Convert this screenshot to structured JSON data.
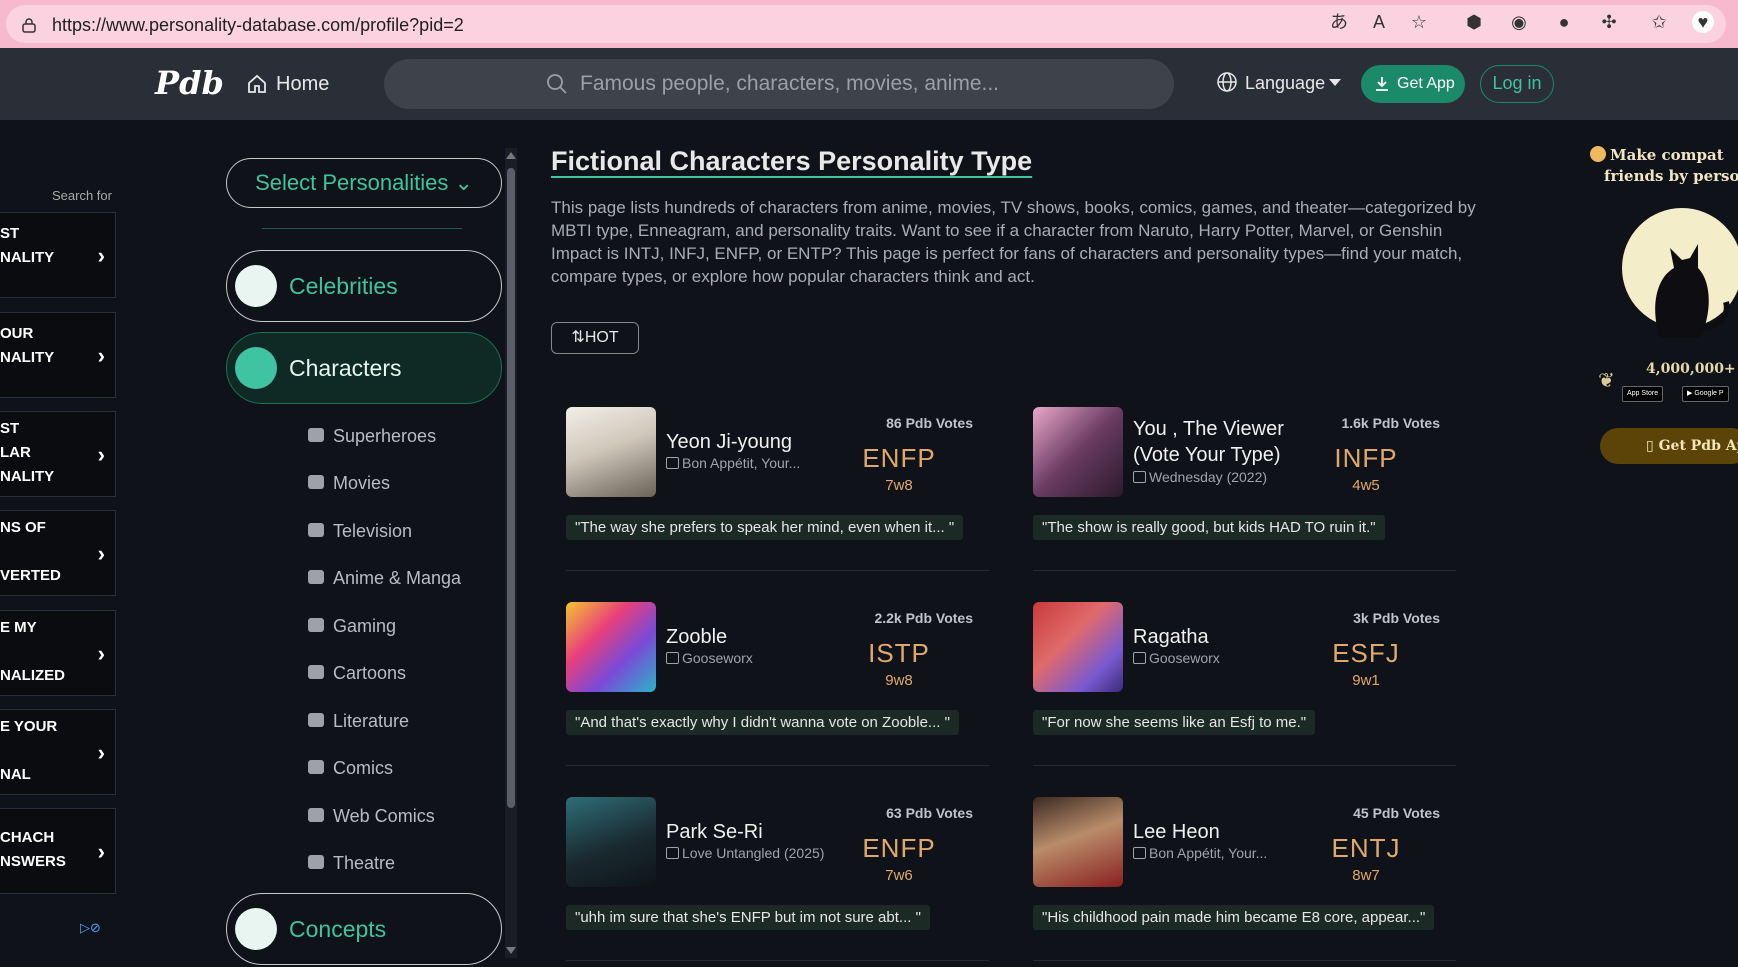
{
  "browser": {
    "url": "https://www.personality-database.com/profile?pid=2"
  },
  "nav": {
    "logo": "Pdb",
    "home": "Home",
    "search_placeholder": "Famous people, characters, movies, anime...",
    "language": "Language",
    "get_app": "Get App",
    "login": "Log in"
  },
  "ad": {
    "search_for": "Search for",
    "items": [
      {
        "line1": "ST",
        "line2": "NALITY"
      },
      {
        "line1": "OUR",
        "line2": "NALITY"
      },
      {
        "line1": "ST",
        "line2": "LAR",
        "line3": "NALITY"
      },
      {
        "line1": "NS OF",
        "line2": "VERTED"
      },
      {
        "line1": "E MY",
        "line2": "NALIZED"
      },
      {
        "line1": "E YOUR",
        "line2": "NAL"
      },
      {
        "line1": "CHACH",
        "line2": "NSWERS"
      }
    ]
  },
  "sidebar": {
    "select": "Select Personalities",
    "categories": [
      {
        "label": "Celebrities"
      },
      {
        "label": "Characters"
      },
      {
        "label": "Concepts"
      }
    ],
    "subcategories": [
      {
        "label": "Superheroes"
      },
      {
        "label": "Movies"
      },
      {
        "label": "Television"
      },
      {
        "label": "Anime & Manga"
      },
      {
        "label": "Gaming"
      },
      {
        "label": "Cartoons"
      },
      {
        "label": "Literature"
      },
      {
        "label": "Comics"
      },
      {
        "label": "Web Comics"
      },
      {
        "label": "Theatre"
      }
    ]
  },
  "main": {
    "title": "Fictional Characters Personality Type",
    "description": "This page lists hundreds of characters from anime, movies, TV shows, books, comics, games, and theater—categorized by MBTI type, Enneagram, and personality traits. Want to see if a character from Naruto, Harry Potter, Marvel, or Genshin Impact is INTJ, INFJ, ENFP, or ENTP? This page is perfect for fans of characters and personality types—find your match, compare types, or explore how popular characters think and act.",
    "sort": "HOT",
    "cards": [
      {
        "name": "Yeon Ji-young",
        "source": "Bon Appétit, Your...",
        "votes": "86 Pdb Votes",
        "type": "ENFP",
        "enneagram": "7w8",
        "quote": "\"The way she prefers to speak her mind, even when it...  \""
      },
      {
        "name": "You , The Viewer (Vote Your Type)",
        "source": "Wednesday (2022)",
        "votes": "1.6k Pdb Votes",
        "type": "INFP",
        "enneagram": "4w5",
        "quote": "\"The show is really good, but kids HAD TO ruin it.\""
      },
      {
        "name": "Zooble",
        "source": "Gooseworx",
        "votes": "2.2k Pdb Votes",
        "type": "ISTP",
        "enneagram": "9w8",
        "quote": "\"And that's exactly why I didn't wanna vote on Zooble...  \""
      },
      {
        "name": "Ragatha",
        "source": "Gooseworx",
        "votes": "3k Pdb Votes",
        "type": "ESFJ",
        "enneagram": "9w1",
        "quote": "\"For now she seems like an Esfj to me.\""
      },
      {
        "name": "Park Se-Ri",
        "source": "Love Untangled (2025)",
        "votes": "63 Pdb Votes",
        "type": "ENFP",
        "enneagram": "7w6",
        "quote": "\"uhh im sure that she's ENFP but im not sure abt...      \""
      },
      {
        "name": "Lee Heon",
        "source": "Bon Appétit, Your...",
        "votes": "45 Pdb Votes",
        "type": "ENTJ",
        "enneagram": "8w7",
        "quote": "\"His childhood pain made him became E8 core, appear...\""
      }
    ]
  },
  "promo": {
    "line1": "Make compat",
    "line2": "friends by persona",
    "count": "4,000,000+",
    "app_store": "App Store",
    "google_play": "Google P",
    "button": "Get Pdb App"
  },
  "colors": {
    "accent": "#3fc3a0",
    "type_color": "#e0a96c",
    "background": "#0f1218",
    "nav": "#2a2e36"
  }
}
